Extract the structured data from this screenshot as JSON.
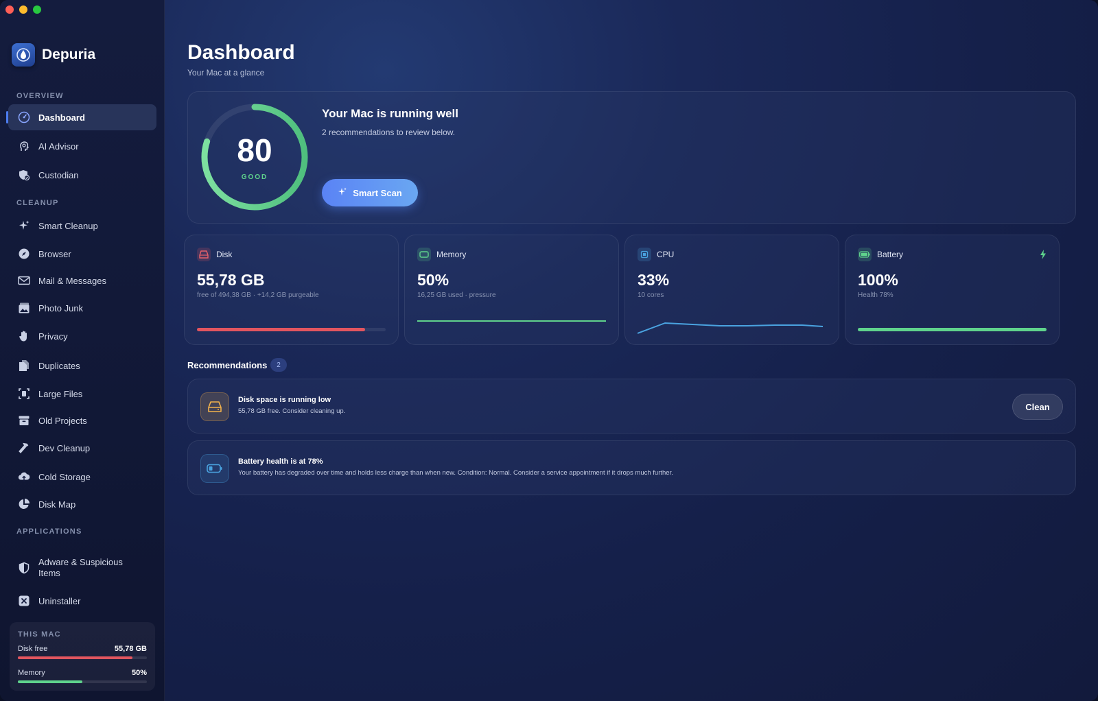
{
  "app": {
    "name": "Depuria"
  },
  "sidebar": {
    "sections": {
      "overview": "OVERVIEW",
      "cleanup": "CLEANUP",
      "applications": "APPLICATIONS"
    },
    "items": [
      {
        "label": "Dashboard",
        "icon": "gauge-icon",
        "active": true
      },
      {
        "label": "AI Advisor",
        "icon": "head-icon"
      },
      {
        "label": "Custodian",
        "icon": "shield-check-icon"
      },
      {
        "label": "Smart Cleanup",
        "icon": "sparkles-icon"
      },
      {
        "label": "Browser",
        "icon": "compass-icon"
      },
      {
        "label": "Mail & Messages",
        "icon": "envelope-icon"
      },
      {
        "label": "Photo Junk",
        "icon": "photo-icon"
      },
      {
        "label": "Privacy",
        "icon": "hand-icon"
      },
      {
        "label": "Duplicates",
        "icon": "documents-icon"
      },
      {
        "label": "Large Files",
        "icon": "file-scan-icon"
      },
      {
        "label": "Old Projects",
        "icon": "archive-icon"
      },
      {
        "label": "Dev Cleanup",
        "icon": "hammer-icon"
      },
      {
        "label": "Cold Storage",
        "icon": "cloud-upload-icon"
      },
      {
        "label": "Disk Map",
        "icon": "pie-icon"
      },
      {
        "label": "Adware & Suspicious Items",
        "icon": "shield-half-icon"
      },
      {
        "label": "Uninstaller",
        "icon": "x-square-icon"
      }
    ],
    "this_mac": {
      "title": "THIS MAC",
      "disk_label": "Disk free",
      "disk_value": "55,78 GB",
      "disk_fraction": 0.89,
      "memory_label": "Memory",
      "memory_value": "50%",
      "memory_fraction": 0.5
    }
  },
  "header": {
    "title": "Dashboard",
    "subtitle": "Your Mac at a glance"
  },
  "health": {
    "score": "80",
    "score_fraction": 0.8,
    "grade": "GOOD",
    "title": "Your Mac is running well",
    "subtitle": "2 recommendations to review below.",
    "scan_button": "Smart Scan"
  },
  "metrics": {
    "disk": {
      "label": "Disk",
      "value": "55,78 GB",
      "sub": "free of 494,38 GB · +14,2 GB purgeable",
      "fraction": 0.89
    },
    "memory": {
      "label": "Memory",
      "value": "50%",
      "sub": "16,25 GB used · pressure"
    },
    "cpu": {
      "label": "CPU",
      "value": "33%",
      "sub": "10 cores"
    },
    "battery": {
      "label": "Battery",
      "value": "100%",
      "sub": "Health 78%",
      "fraction": 1.0
    }
  },
  "recommendations": {
    "title": "Recommendations",
    "count": "2",
    "items": [
      {
        "title": "Disk space is running low",
        "body": "55,78 GB free. Consider cleaning up.",
        "action": "Clean",
        "icon": "drive-icon"
      },
      {
        "title": "Battery health is at 78%",
        "body": "Your battery has degraded over time and holds less charge than when new. Condition: Normal. Consider a service appointment if it drops much further.",
        "icon": "battery-low-icon"
      }
    ]
  },
  "colors": {
    "accent": "#5a83f5",
    "good": "#5fd38c",
    "disk_bar": "#e2555f",
    "memory_line": "#5fd38c",
    "cpu_line": "#4aa3e0",
    "battery_bar": "#5fd38c"
  }
}
